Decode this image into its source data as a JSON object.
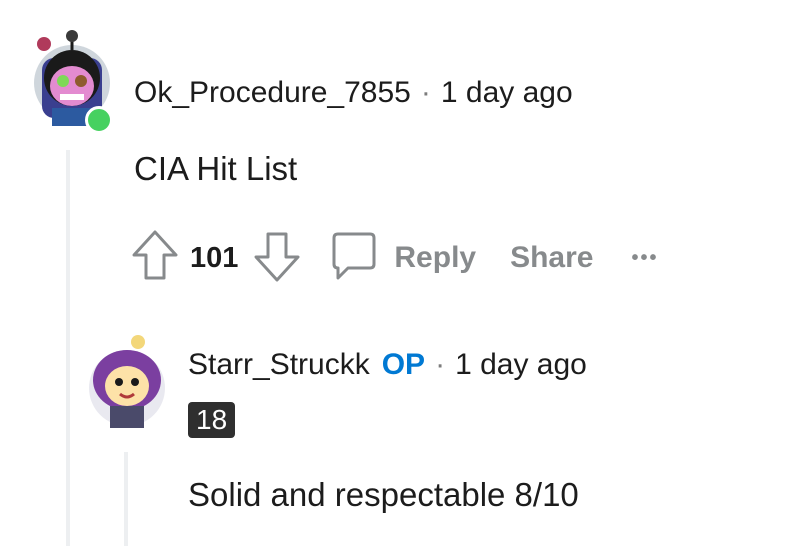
{
  "comment": {
    "username": "Ok_Procedure_7855",
    "separator": "·",
    "time": "1 day ago",
    "text": "CIA Hit List",
    "score": "101",
    "actions": {
      "reply": "Reply",
      "share": "Share",
      "more": "•••"
    }
  },
  "reply": {
    "username": "Starr_Struckk",
    "op_badge": "OP",
    "separator": "·",
    "time": "1 day ago",
    "flair": "18",
    "text": "Solid and respectable 8/10"
  },
  "colors": {
    "accent_op": "#0079d3",
    "online": "#46d160",
    "muted": "#878a8c",
    "thread_line": "#edeff1"
  }
}
